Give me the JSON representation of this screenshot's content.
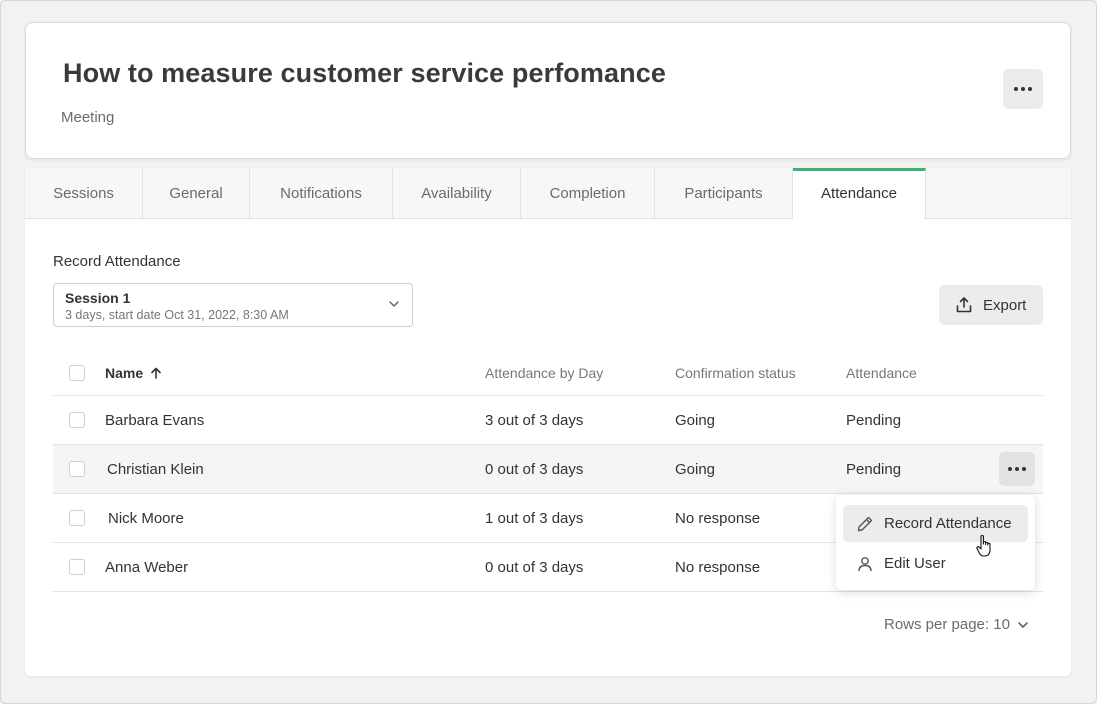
{
  "header": {
    "title": "How to measure customer service perfomance",
    "subtitle": "Meeting",
    "more_icon": "more-horizontal-icon"
  },
  "tabs": [
    {
      "label": "Sessions",
      "active": false
    },
    {
      "label": "General",
      "active": false
    },
    {
      "label": "Notifications",
      "active": false
    },
    {
      "label": "Availability",
      "active": false
    },
    {
      "label": "Completion",
      "active": false
    },
    {
      "label": "Participants",
      "active": false
    },
    {
      "label": "Attendance",
      "active": true
    }
  ],
  "attendance": {
    "section_label": "Record Attendance",
    "session": {
      "name": "Session 1",
      "detail": "3 days, start date Oct 31, 2022, 8:30 AM"
    },
    "export_label": "Export",
    "columns": {
      "name": "Name",
      "by_day": "Attendance by Day",
      "confirmation": "Confirmation status",
      "attendance": "Attendance"
    },
    "rows": [
      {
        "name": "Barbara Evans",
        "by_day": "3 out of 3 days",
        "confirmation": "Going",
        "attendance": "Pending"
      },
      {
        "name": "Christian Klein",
        "by_day": "0 out of 3 days",
        "confirmation": "Going",
        "attendance": "Pending"
      },
      {
        "name": "Nick Moore",
        "by_day": "1 out of 3 days",
        "confirmation": "No response",
        "attendance": ""
      },
      {
        "name": "Anna Weber",
        "by_day": "0 out of 3 days",
        "confirmation": "No response",
        "attendance": ""
      }
    ],
    "menu": {
      "record_attendance": "Record Attendance",
      "edit_user": "Edit User"
    },
    "rows_per_page": "Rows per page: 10"
  },
  "colors": {
    "accent": "#3cb371",
    "background": "#f2f2f2"
  }
}
